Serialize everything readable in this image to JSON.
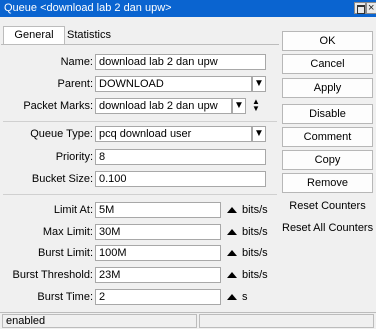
{
  "window": {
    "title": "Queue <download lab 2 dan upw>",
    "close_glyph": "×"
  },
  "tabs": [
    {
      "label": "General",
      "active": true
    },
    {
      "label": "Statistics",
      "active": false
    }
  ],
  "form": {
    "name": {
      "label": "Name:",
      "value": "download lab 2 dan upw"
    },
    "parent": {
      "label": "Parent:",
      "value": "DOWNLOAD"
    },
    "packet_marks": {
      "label": "Packet Marks:",
      "value": "download lab 2 dan upw"
    },
    "queue_type": {
      "label": "Queue Type:",
      "value": "pcq download user"
    },
    "priority": {
      "label": "Priority:",
      "value": "8"
    },
    "bucket_size": {
      "label": "Bucket Size:",
      "value": "0.100"
    },
    "limit_at": {
      "label": "Limit At:",
      "value": "5M",
      "unit": "bits/s"
    },
    "max_limit": {
      "label": "Max Limit:",
      "value": "30M",
      "unit": "bits/s"
    },
    "burst_limit": {
      "label": "Burst Limit:",
      "value": "100M",
      "unit": "bits/s"
    },
    "burst_threshold": {
      "label": "Burst Threshold:",
      "value": "23M",
      "unit": "bits/s"
    },
    "burst_time": {
      "label": "Burst Time:",
      "value": "2",
      "unit": "s"
    }
  },
  "buttons": {
    "ok": "OK",
    "cancel": "Cancel",
    "apply": "Apply",
    "disable": "Disable",
    "comment": "Comment",
    "copy": "Copy",
    "remove": "Remove",
    "reset_counters": "Reset Counters",
    "reset_all_counters": "Reset All Counters"
  },
  "status": {
    "state": "enabled"
  },
  "icons": {
    "dropdown": "dropdown-arrow-icon",
    "updown": "up-down-arrows-icon",
    "expand": "triangle-up-icon"
  },
  "colors": {
    "titlebar": "#0a64d0",
    "window_bg": "#f0f0f0"
  }
}
